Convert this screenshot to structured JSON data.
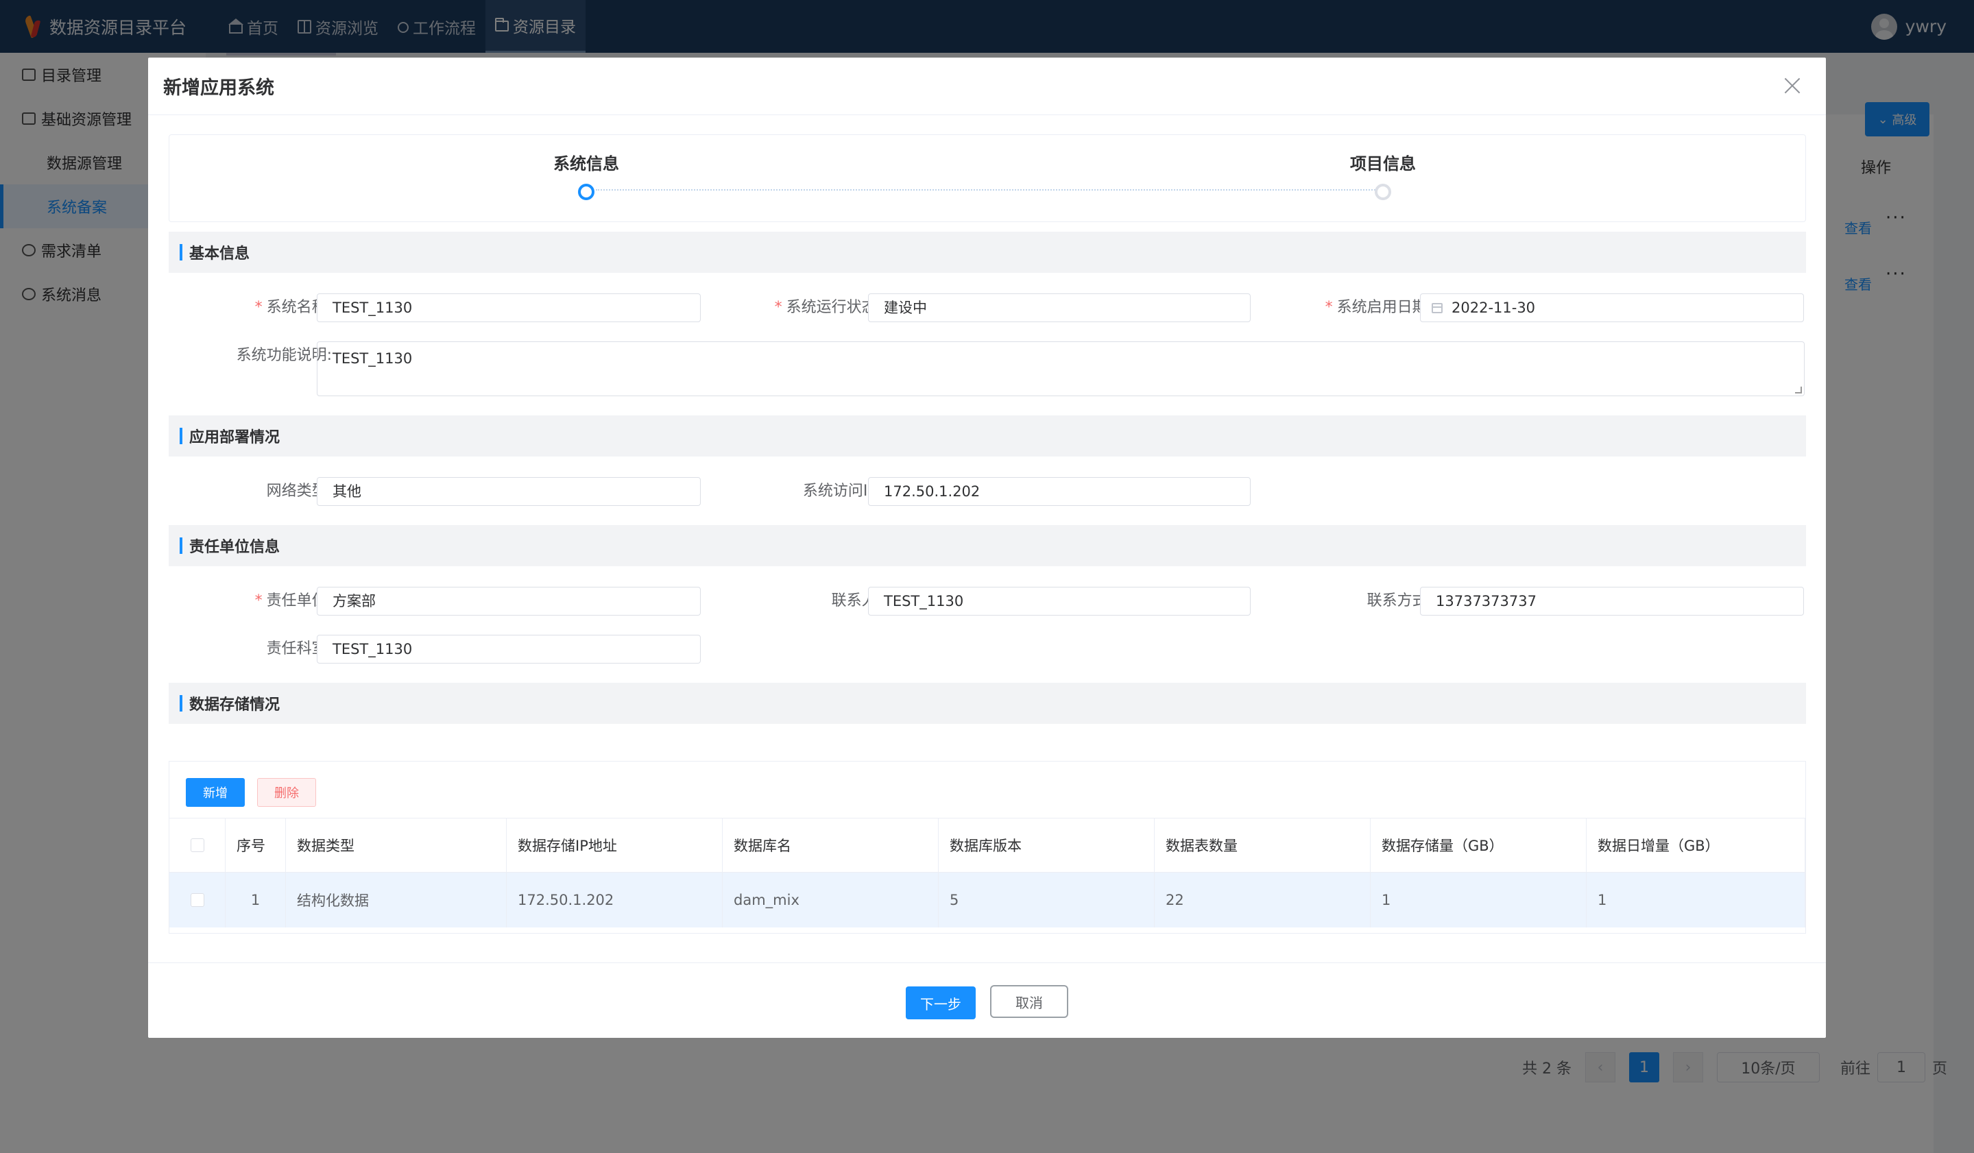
{
  "app": {
    "title": "数据资源目录平台",
    "nav": [
      {
        "label": "首页",
        "icon": "home-icon"
      },
      {
        "label": "资源浏览",
        "icon": "book-icon"
      },
      {
        "label": "工作流程",
        "icon": "workflow-icon"
      },
      {
        "label": "资源目录",
        "icon": "folder-icon",
        "active": true
      }
    ],
    "user": "ywry"
  },
  "sidebar": {
    "items": [
      {
        "label": "目录管理"
      },
      {
        "label": "基础资源管理"
      },
      {
        "label": "数据源管理"
      },
      {
        "label": "系统备案",
        "active": true
      },
      {
        "label": "需求清单"
      },
      {
        "label": "系统消息"
      }
    ]
  },
  "background": {
    "advanced_label": "高级",
    "ops_header": "操作",
    "view_link": "查看",
    "more": "···",
    "pager": {
      "total": "共 2 条",
      "current": "1",
      "page_size": "10条/页",
      "goto": "前往",
      "goto_value": "1",
      "page_unit": "页"
    }
  },
  "dialog": {
    "title": "新增应用系统",
    "steps": [
      {
        "label": "系统信息",
        "state": "active"
      },
      {
        "label": "项目信息",
        "state": "wait"
      }
    ],
    "sections": {
      "basic": "基本信息",
      "deploy": "应用部署情况",
      "owner": "责任单位信息",
      "storage": "数据存储情况"
    },
    "fields": {
      "system_name": {
        "label": "系统名称:",
        "value": "TEST_1130",
        "required": true
      },
      "run_status": {
        "label": "系统运行状态:",
        "value": "建设中",
        "required": true
      },
      "start_date": {
        "label": "系统启用日期:",
        "value": "2022-11-30",
        "required": true
      },
      "function_desc": {
        "label": "系统功能说明:",
        "value": "TEST_1130"
      },
      "network_type": {
        "label": "网络类型:",
        "value": "其他"
      },
      "access_ip": {
        "label": "系统访问IP:",
        "value": "172.50.1.202"
      },
      "owner_unit": {
        "label": "责任单位:",
        "value": "方案部",
        "required": true
      },
      "contact": {
        "label": "联系人:",
        "value": "TEST_1130"
      },
      "contact_phone": {
        "label": "联系方式:",
        "value": "13737373737"
      },
      "owner_dept": {
        "label": "责任科室:",
        "value": "TEST_1130"
      }
    },
    "storage": {
      "add_label": "新增",
      "delete_label": "删除",
      "columns": [
        "序号",
        "数据类型",
        "数据存储IP地址",
        "数据库名",
        "数据库版本",
        "数据表数量",
        "数据存储量（GB）",
        "数据日增量（GB）"
      ],
      "rows": [
        [
          "1",
          "结构化数据",
          "172.50.1.202",
          "dam_mix",
          "5",
          "22",
          "1",
          "1"
        ]
      ]
    },
    "footer": {
      "next_label": "下一步",
      "cancel_label": "取消"
    }
  }
}
